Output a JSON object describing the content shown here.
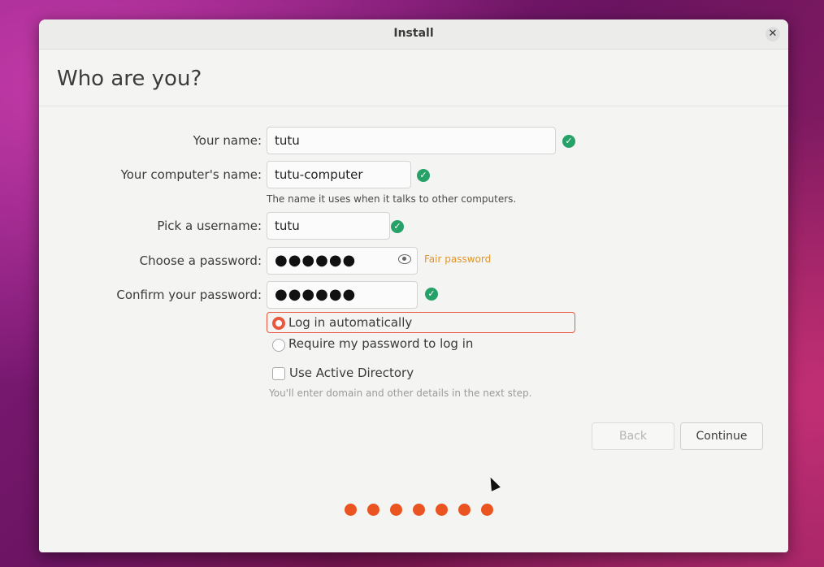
{
  "window": {
    "title": "Install"
  },
  "page": {
    "heading": "Who are you?"
  },
  "form": {
    "name_label": "Your name:",
    "name_value": "tutu",
    "computer_label": "Your computer's name:",
    "computer_value": "tutu-computer",
    "computer_hint": "The name it uses when it talks to other computers.",
    "username_label": "Pick a username:",
    "username_value": "tutu",
    "password_label": "Choose a password:",
    "password_value": "●●●●●●",
    "password_strength": "Fair password",
    "confirm_label": "Confirm your password:",
    "confirm_value": "●●●●●●"
  },
  "options": {
    "login_auto": "Log in automatically",
    "login_password": "Require my password to log in",
    "active_directory": "Use Active Directory",
    "ad_hint": "You'll enter domain and other details in the next step."
  },
  "buttons": {
    "back": "Back",
    "continue": "Continue"
  },
  "progress": {
    "dots": 7,
    "active": 7
  },
  "colors": {
    "accent": "#e95420",
    "valid": "#26a269",
    "warning": "#e0952a"
  },
  "icons": [
    "close-icon",
    "check-icon",
    "eye-icon",
    "mouse-cursor"
  ]
}
